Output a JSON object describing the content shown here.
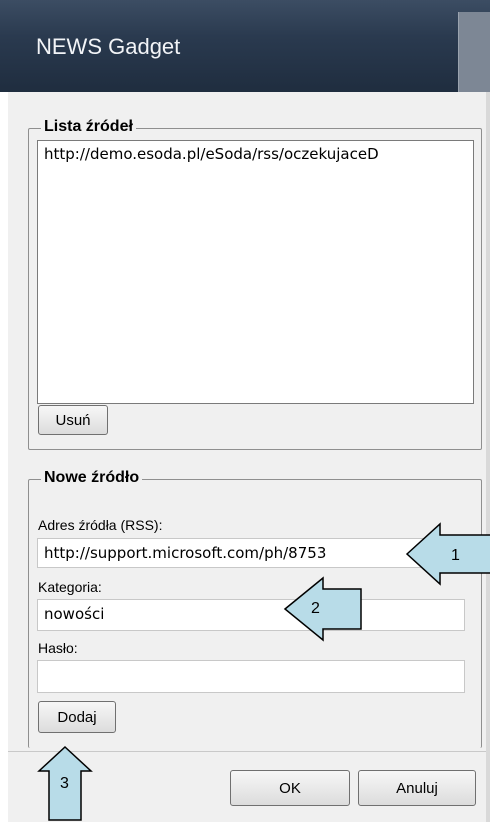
{
  "window": {
    "title": "NEWS Gadget"
  },
  "sources_group": {
    "legend": "Lista źródeł",
    "items": [
      "http://demo.esoda.pl/eSoda/rss/oczekujaceD"
    ],
    "remove_button": "Usuń"
  },
  "new_source_group": {
    "legend": "Nowe źródło",
    "address_label": "Adres źródła (RSS):",
    "address_value": "http://support.microsoft.com/ph/8753",
    "category_label": "Kategoria:",
    "category_value": "nowości",
    "password_label": "Hasło:",
    "password_value": "",
    "add_button": "Dodaj"
  },
  "footer": {
    "ok_button": "OK",
    "cancel_button": "Anuluj"
  },
  "callouts": [
    "1",
    "2",
    "3"
  ],
  "colors": {
    "titlebar": "#2a3a4f",
    "callout_fill": "#b8dce8",
    "dialog_bg": "#f0f0f0"
  }
}
